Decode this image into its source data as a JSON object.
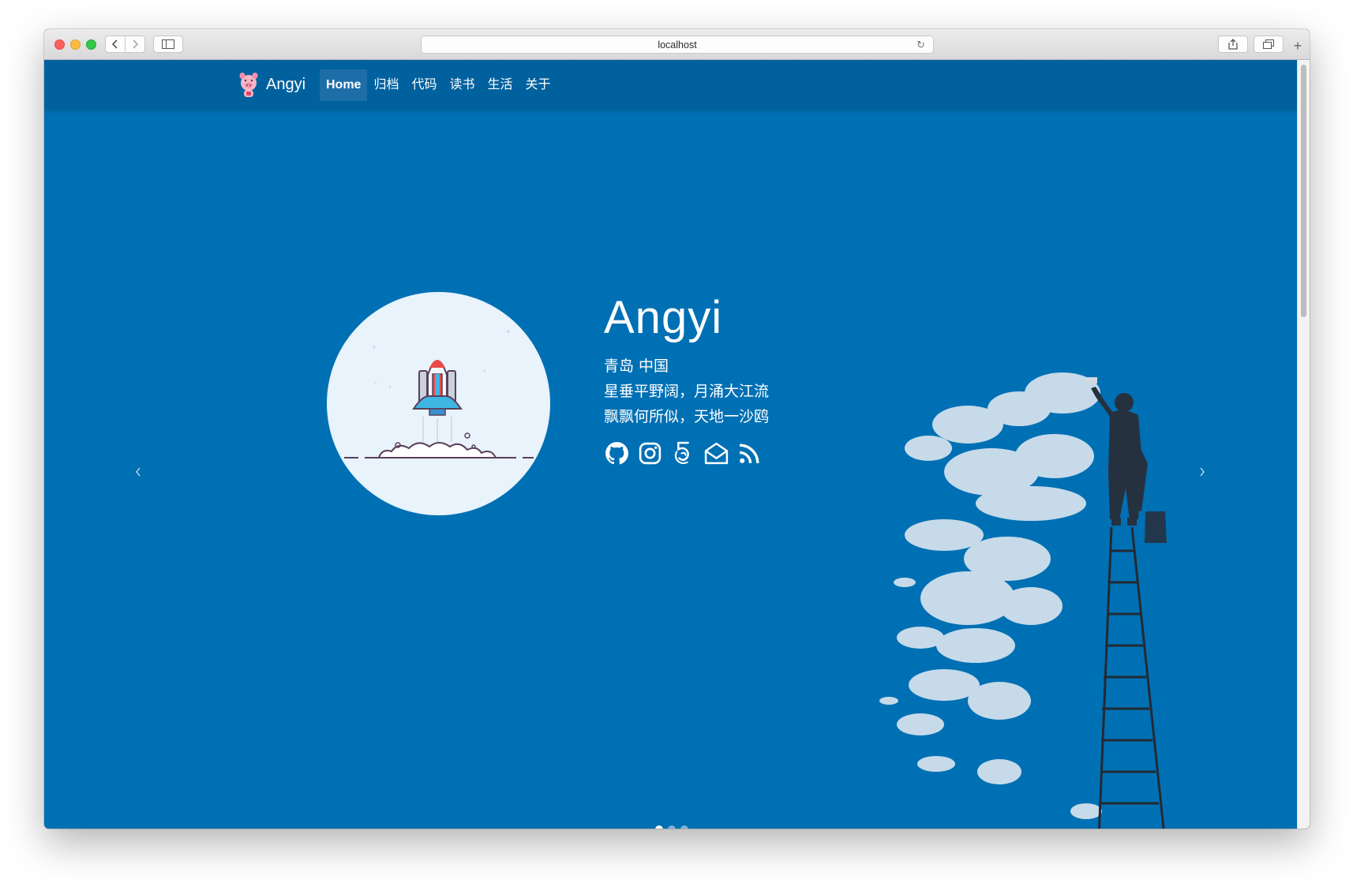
{
  "browser": {
    "url": "localhost",
    "icons": {
      "back": "chevron-left-icon",
      "forward": "chevron-right-icon",
      "sidebar": "sidebar-icon",
      "reload": "reload-icon",
      "share": "share-icon",
      "tabs": "tabs-icon",
      "new_tab": "plus-icon"
    }
  },
  "navbar": {
    "brand": "Angyi",
    "items": [
      {
        "label": "Home",
        "active": true
      },
      {
        "label": "归档"
      },
      {
        "label": "代码"
      },
      {
        "label": "读书"
      },
      {
        "label": "生活"
      },
      {
        "label": "关于"
      }
    ]
  },
  "hero": {
    "name": "Angyi",
    "location": "青岛 中国",
    "quote_line1": "星垂平野阔，月涌大江流",
    "quote_line2": "飘飘何所似，天地一沙鸥",
    "social_icons": [
      "github-icon",
      "instagram-icon",
      "500px-icon",
      "email-icon",
      "rss-icon"
    ],
    "carousel": {
      "slides": 3,
      "active_slide": 1
    }
  },
  "colors": {
    "background": "#0070b4",
    "navbar": "#00619e",
    "nav_active": "#1d6ea8",
    "avatar_bg": "#e8f3fc"
  }
}
